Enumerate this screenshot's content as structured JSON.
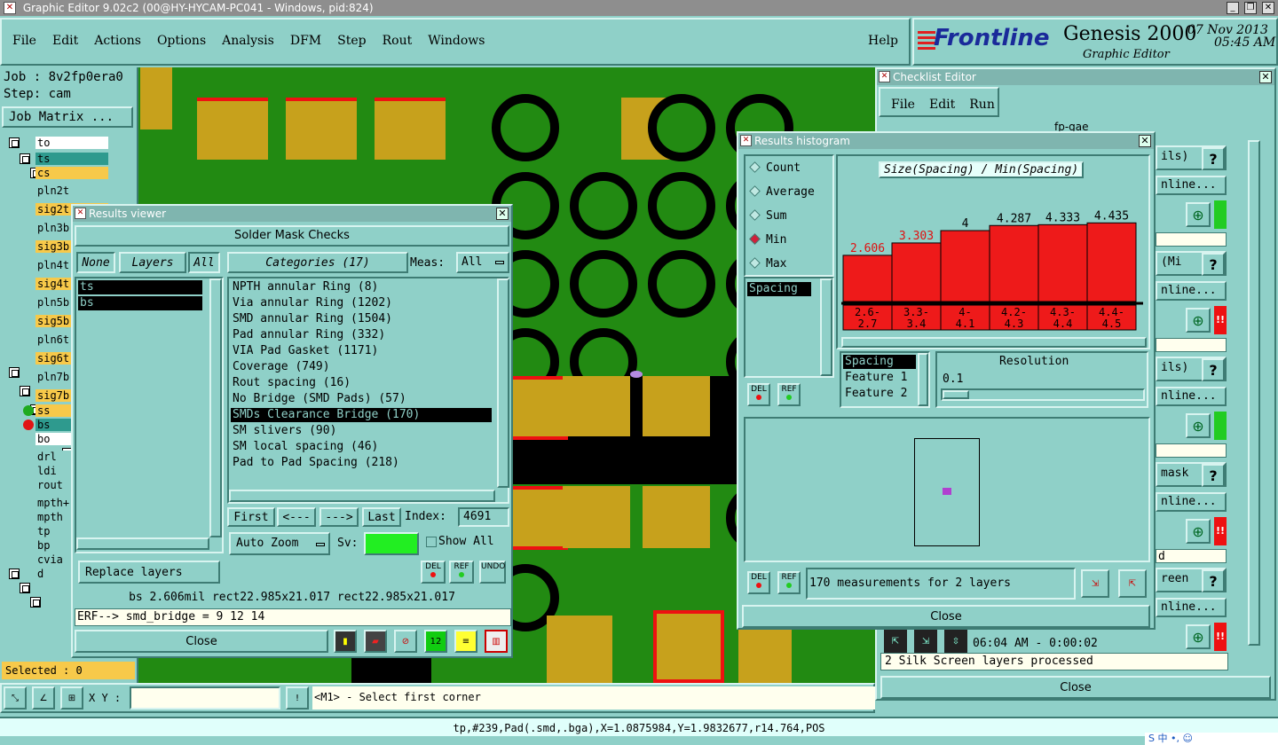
{
  "window_title": "Graphic Editor 9.02c2 (00@HY-HYCAM-PC041 - Windows, pid:824)",
  "menu": [
    "File",
    "Edit",
    "Actions",
    "Options",
    "Analysis",
    "DFM",
    "Step",
    "Rout",
    "Windows"
  ],
  "help": "Help",
  "brand": {
    "logo": "Frontline",
    "product": "Genesis 2000",
    "subtitle": "Graphic Editor",
    "date": "07 Nov 2013",
    "time": "05:45 AM"
  },
  "left_panel": {
    "job": "Job : 8v2fp0era0",
    "step": "Step: cam",
    "job_matrix": "Job Matrix ...",
    "layers": [
      "to",
      "ts",
      "cs",
      "pln2t",
      "sig2t",
      "pln3b",
      "sig3b",
      "pln4t",
      "sig4t",
      "pln5b",
      "sig5b",
      "pln6t",
      "sig6t",
      "pln7b",
      "sig7b",
      "ss",
      "bs",
      "bo",
      "drl",
      "ldi",
      "rout",
      "mpth+",
      "mpth",
      "tp",
      "bp",
      "cvia",
      "d"
    ],
    "selected": "Selected : 0"
  },
  "results_viewer": {
    "title": "Results viewer",
    "header": "Solder Mask Checks",
    "none_btn": "None",
    "layers_btn": "Layers",
    "all_btn": "All",
    "categories_btn": "Categories (17)",
    "meas_label": "Meas:",
    "meas_value": "All",
    "layer_list": [
      "ts",
      "bs"
    ],
    "categories": [
      "NPTH annular Ring (8)",
      "Via annular Ring (1202)",
      "SMD annular Ring (1504)",
      "Pad annular Ring (332)",
      "VIA Pad Gasket (1171)",
      "Coverage (749)",
      "Rout spacing (16)",
      "No Bridge (SMD Pads) (57)",
      "SMDs Clearance Bridge (170)",
      "SM slivers (90)",
      "SM local spacing (46)",
      "Pad to Pad Spacing (218)"
    ],
    "first": "First",
    "prev": "<---",
    "next": "--->",
    "last": "Last",
    "index_label": "Index:",
    "index_value": "4691",
    "auto_zoom": "Auto Zoom",
    "sv_label": "Sv:",
    "show_all": "Show All",
    "replace_layers": "Replace layers",
    "del": "DEL",
    "ref": "REF",
    "undo": "UNDO",
    "status": "bs 2.606mil  rect22.985x21.017  rect22.985x21.017",
    "erf": "ERF--> smd_bridge = 9 12 14",
    "close": "Close"
  },
  "histogram": {
    "title": "Results histogram",
    "options": [
      "Count",
      "Average",
      "Sum",
      "Min",
      "Max"
    ],
    "selected_option": "Min",
    "chart_title": "Size(Spacing) / Min(Spacing)",
    "list_item": "Spacing",
    "del": "DEL",
    "ref": "REF",
    "field_list": [
      "Spacing",
      "Feature 1",
      "Feature 2"
    ],
    "resolution_label": "Resolution",
    "resolution_value": "0.1",
    "measurements": "170 measurements for 2 layers",
    "close": "Close"
  },
  "chart_data": {
    "type": "bar",
    "title": "Size(Spacing) / Min(Spacing)",
    "categories": [
      "2.6-2.7",
      "3.3-3.4",
      "4-4.1",
      "4.2-4.3",
      "4.3-4.4",
      "4.4-4.5"
    ],
    "values": [
      2.606,
      3.303,
      4,
      4.287,
      4.333,
      4.435
    ],
    "ylim": [
      0,
      5
    ]
  },
  "checklist": {
    "title": "Checklist Editor",
    "menu": [
      "File",
      "Edit",
      "Run"
    ],
    "name": "fp-gae",
    "rows": [
      "ils)",
      "nline...",
      "(Mi",
      "nline...",
      "ils)",
      "nline...",
      "mask",
      "nline...",
      "reen",
      "nline..."
    ],
    "d_text": "d",
    "timestamp": "06:04 AM - 0:00:02",
    "processed": "2 Silk Screen layers processed",
    "close": "Close"
  },
  "bottom": {
    "xy_label": "X Y :",
    "prompt": "<M1> - Select first corner",
    "status": "tp,#239,Pad(.smd,.bga),X=1.0875984,Y=1.9832677,r14.764,POS"
  },
  "tray": "S 中 •, ☺"
}
